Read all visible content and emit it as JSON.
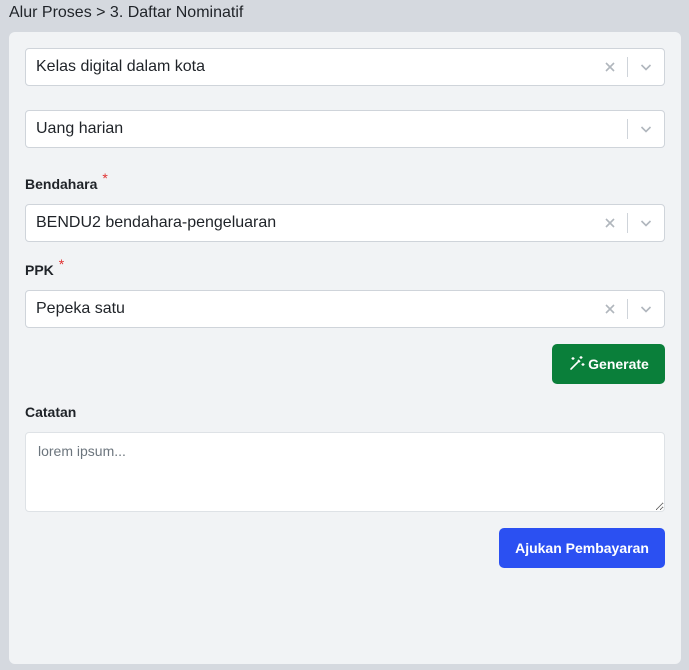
{
  "breadcrumb": "Alur Proses > 3. Daftar Nominatif",
  "form": {
    "select_kelas": {
      "value": "Kelas digital dalam kota"
    },
    "select_jenis": {
      "value": "Uang harian"
    },
    "bendahara": {
      "label": "Bendahara",
      "required_mark": "*",
      "value": "BENDU2 bendahara-pengeluaran"
    },
    "ppk": {
      "label": "PPK",
      "required_mark": "*",
      "value": "Pepeka satu"
    },
    "generate_label": "Generate",
    "catatan": {
      "label": "Catatan",
      "placeholder": "lorem ipsum..."
    },
    "submit_label": "Ajukan Pembayaran"
  },
  "colors": {
    "generate_button": "#0a7f3a",
    "submit_button": "#2b50f2",
    "required": "#e03131"
  },
  "icons": {
    "clear": "close-icon",
    "dropdown": "chevron-down-icon",
    "generate": "magic-wand-icon"
  }
}
